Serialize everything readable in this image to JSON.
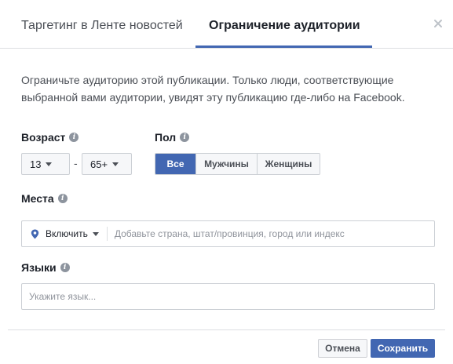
{
  "tabs": [
    {
      "label": "Таргетинг в Ленте новостей",
      "active": false
    },
    {
      "label": "Ограничение аудитории",
      "active": true
    }
  ],
  "close_icon": "close-icon",
  "description": "Ограничьте аудиторию этой публикации. Только люди, соответствующие выбранной вами аудитории, увидят эту публикацию где-либо на Facebook.",
  "age": {
    "label": "Возраст",
    "min": "13",
    "separator": "-",
    "max": "65+"
  },
  "gender": {
    "label": "Пол",
    "options": [
      "Все",
      "Мужчины",
      "Женщины"
    ],
    "selected": "Все"
  },
  "places": {
    "label": "Места",
    "mode": "Включить",
    "placeholder": "Добавьте страна, штат/провинция, город или индекс"
  },
  "languages": {
    "label": "Языки",
    "placeholder": "Укажите язык..."
  },
  "footer": {
    "cancel_label": "Отмена",
    "save_label": "Сохранить"
  },
  "colors": {
    "accent": "#4267b2",
    "border": "#ccd0d5",
    "muted_text": "#90949c"
  }
}
